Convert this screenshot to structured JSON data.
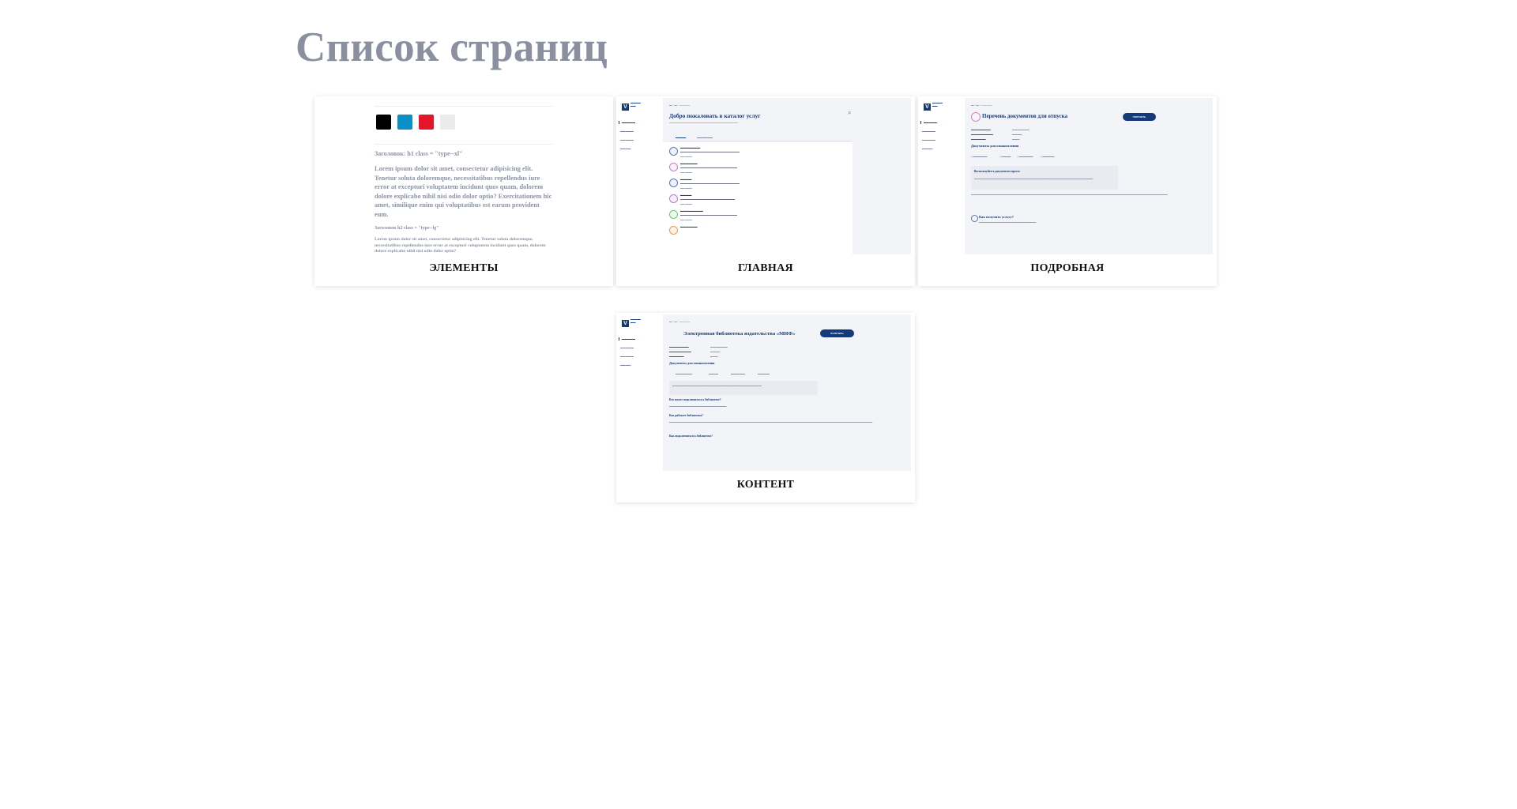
{
  "page": {
    "title": "Список страниц"
  },
  "cards": {
    "elements": {
      "label": "ЭЛЕМЕНТЫ",
      "heading1": "Заголовок: h1 class = \"type--xl\"",
      "lorem1": "Lorem ipsum dolor sit amet, consectetur adipisicing elit. Tenetur soluta doloremque, necessitatibus repellendus iure error at excepturi voluptatem incidunt quos quam, dolorem dolore explicabo nihil nisi odio dolor optio? Exercitationem hic amet, similique enim qui voluptatibus est earum provident eum.",
      "heading2": "Заголовок h2 class = \"type--lg\"",
      "lorem2": "Lorem ipsum dolor sit amet, consectetur adipisicing elit. Tenetur soluta doloremque, necessitatibus repellendus iure error at excepturi voluptatem incidunt quos quam, dolorem dolore explicabo nihil nisi odio dolor optio?",
      "swatches": [
        "#000000",
        "#0a8fc9",
        "#e3162a",
        "#ebebeb"
      ]
    },
    "main": {
      "label": "ГЛАВНАЯ",
      "title": "Добро пожаловать в каталог услуг"
    },
    "detail": {
      "label": "ПОДРОБНАЯ",
      "title": "Перечень документов для отпуска",
      "button": "ПОЛУЧИТЬ",
      "section": "Документы для ознакомления",
      "info_title": "Воспользуйтесь документом просто",
      "faq_title": "Как получить услугу?"
    },
    "content": {
      "label": "КОНТЕНТ",
      "title": "Электронная библиотека издательства «МИФ»",
      "button": "ПОЛУЧИТЬ",
      "section": "Документы для ознакомления",
      "q1": "Кто может подключиться к библиотеке?",
      "q2": "Как работает библиотека?",
      "q3": "Как подключиться к библиотеке?"
    }
  },
  "colors": {
    "title_gray": "#8a909f",
    "brand_navy": "#133a7a"
  }
}
